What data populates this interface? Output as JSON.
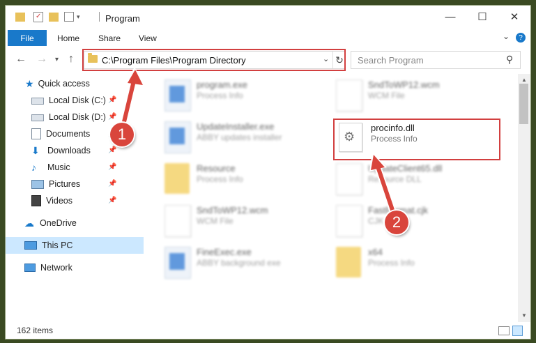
{
  "window": {
    "title": "Program",
    "minimize": "—",
    "maximize": "☐",
    "close": "✕"
  },
  "ribbon": {
    "tabs": [
      "File",
      "Home",
      "Share",
      "View"
    ],
    "expand": "⌄",
    "help": "?"
  },
  "address": {
    "path": "C:\\Program Files\\Program Directory",
    "refresh": "↻"
  },
  "search": {
    "placeholder": "Search Program",
    "icon": "⚲"
  },
  "sidebar": {
    "items": [
      {
        "label": "Quick access",
        "icon": "star-icon"
      },
      {
        "label": "Local Disk (C:)",
        "icon": "drive-icon",
        "pinned": true
      },
      {
        "label": "Local Disk (D:)",
        "icon": "drive-icon",
        "pinned": true
      },
      {
        "label": "Documents",
        "icon": "documents-icon",
        "pinned": true
      },
      {
        "label": "Downloads",
        "icon": "downloads-icon",
        "pinned": true
      },
      {
        "label": "Music",
        "icon": "music-icon",
        "pinned": true
      },
      {
        "label": "Pictures",
        "icon": "pictures-icon",
        "pinned": true
      },
      {
        "label": "Videos",
        "icon": "videos-icon",
        "pinned": true
      },
      {
        "label": "OneDrive",
        "icon": "cloud-icon"
      },
      {
        "label": "This PC",
        "icon": "computer-icon",
        "selected": true
      },
      {
        "label": "Network",
        "icon": "network-icon"
      }
    ]
  },
  "files": [
    {
      "name": "program.exe",
      "desc": "Process Info",
      "type": "exe"
    },
    {
      "name": "SndToWP12.wcm",
      "desc": "WCM File",
      "type": "doc"
    },
    {
      "name": "UpdateInstaller.exe",
      "desc": "ABBY updates installer",
      "type": "exe"
    },
    {
      "name": "procinfo.dll",
      "desc": "Process Info",
      "type": "dll",
      "highlighted": true
    },
    {
      "name": "Resource",
      "desc": "Process Info",
      "type": "folder"
    },
    {
      "name": "UpdateClient65.dll",
      "desc": "Resource DLL",
      "type": "dll"
    },
    {
      "name": "SndToWP12.wcm",
      "desc": "WCM File",
      "type": "doc"
    },
    {
      "name": "FastFormat.cjk",
      "desc": "CJK File",
      "type": "doc"
    },
    {
      "name": "FineExec.exe",
      "desc": "ABBY background exe",
      "type": "exe"
    },
    {
      "name": "x64",
      "desc": "Process Info",
      "type": "folder"
    }
  ],
  "status": {
    "count": "162 items"
  },
  "callouts": [
    "1",
    "2"
  ],
  "colors": {
    "accent": "#1979ca",
    "highlight": "#d23f3f",
    "selection": "#cce8ff"
  }
}
